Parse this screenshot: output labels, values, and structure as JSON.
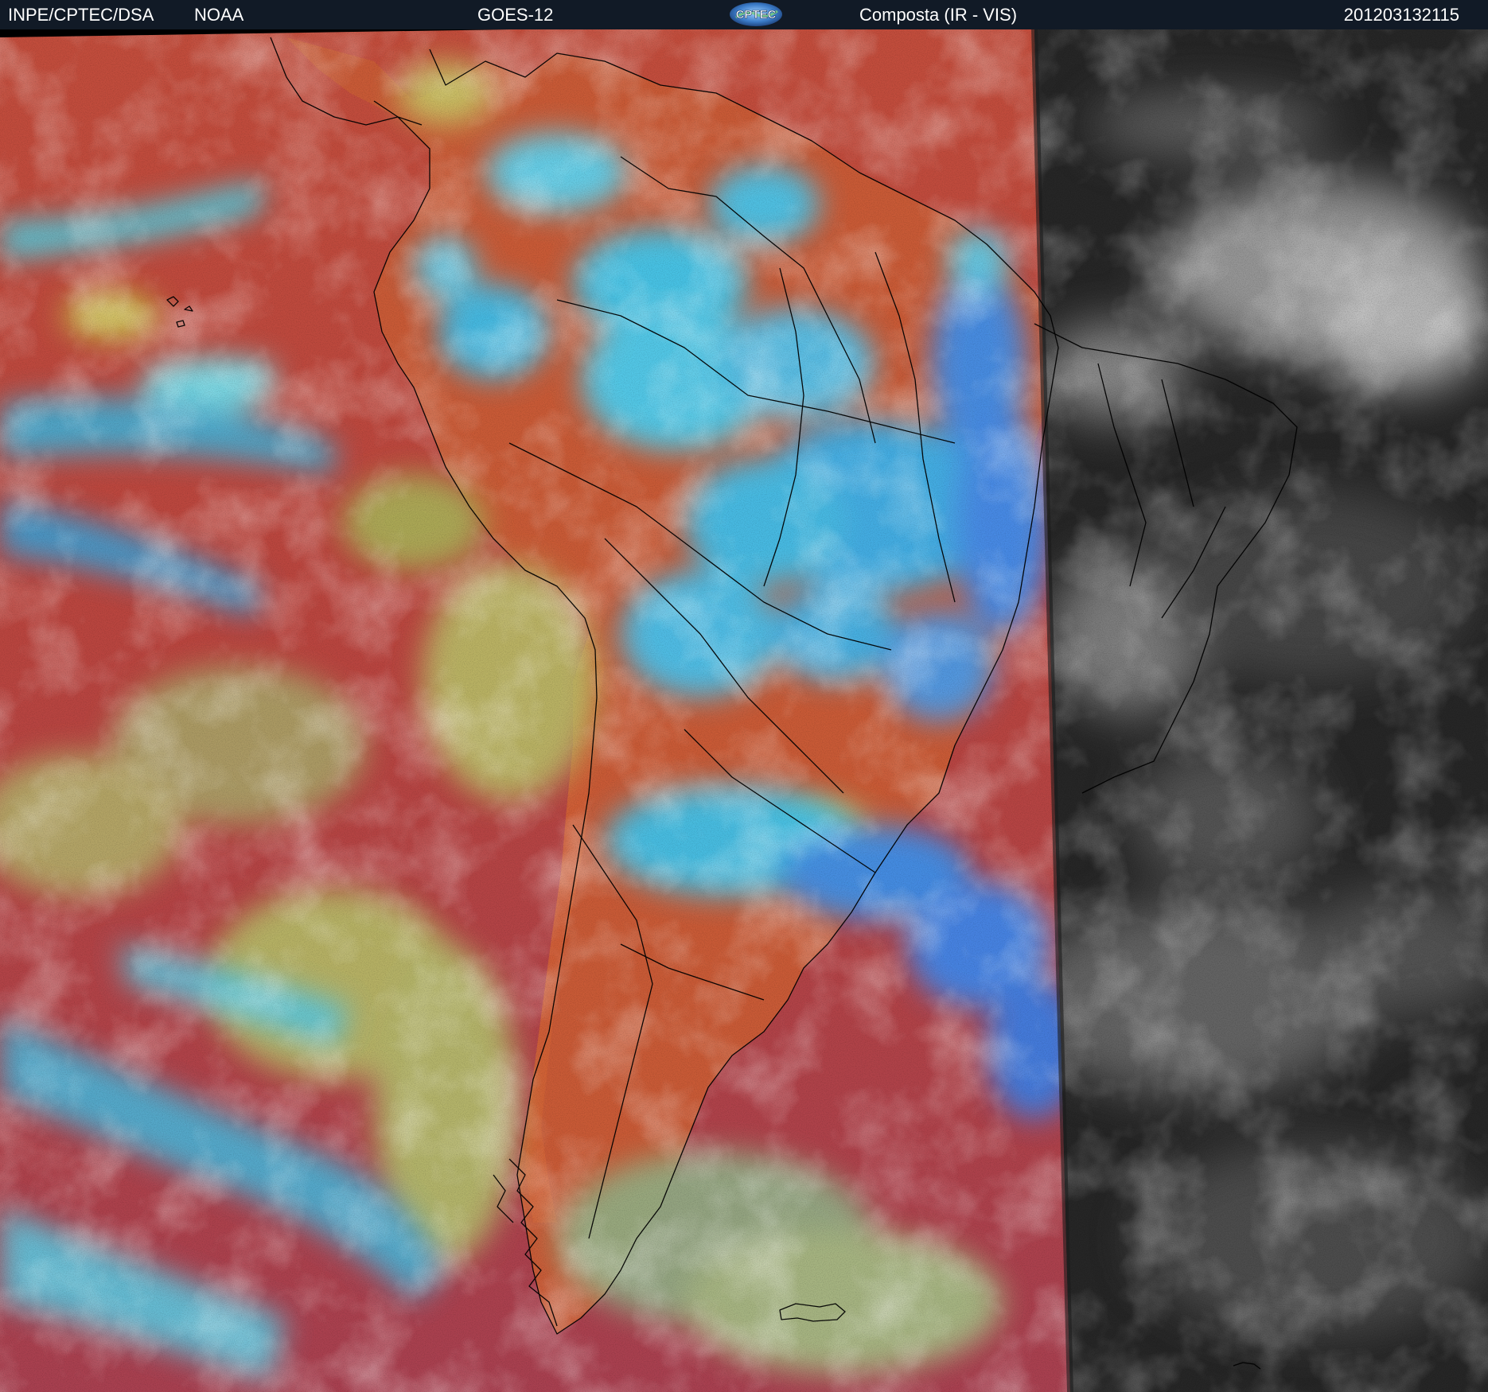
{
  "header": {
    "source": "INPE/CPTEC/DSA",
    "agency": "NOAA",
    "satellite": "GOES-12",
    "logo_text": "CPTEC",
    "product": "Composta (IR - VIS)",
    "timestamp": "201203132115"
  },
  "colors": {
    "header_bg": "#111a26",
    "warm_surface": "#b5433f",
    "land_surface": "#c85635",
    "low_cloud": "#b4c464",
    "high_cloud": "#38c8f0",
    "deep_convection": "#3c8ef2",
    "night_side": "#262626",
    "night_cloud": "#c8c8c8",
    "coastline": "#000000"
  },
  "icons": {
    "logo": "cptec-logo-icon"
  }
}
